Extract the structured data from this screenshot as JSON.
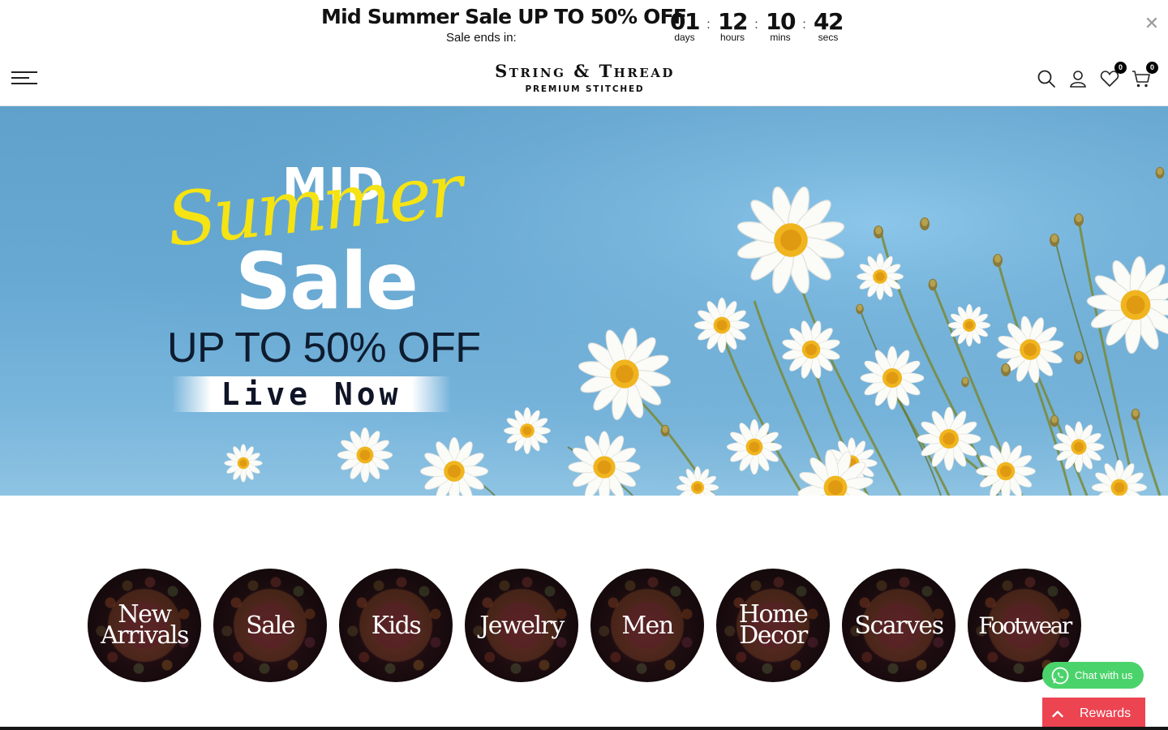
{
  "announcement": {
    "title": "Mid Summer Sale UP TO 50% OFF",
    "subtitle": "Sale ends in:",
    "countdown": [
      {
        "value": "01",
        "label": "days"
      },
      {
        "value": "12",
        "label": "hours"
      },
      {
        "value": "10",
        "label": "mins"
      },
      {
        "value": "42",
        "label": "secs"
      }
    ],
    "separator": ":",
    "close_icon": "close-icon"
  },
  "header": {
    "logo_main": "String & Thread",
    "logo_sub": "PREMIUM STITCHED",
    "icons": [
      "menu-icon",
      "search-icon",
      "account-icon",
      "wishlist-icon",
      "cart-icon"
    ],
    "wishlist_count": "0",
    "cart_count": "0"
  },
  "hero": {
    "line1": "MID",
    "line2": "Summer",
    "line3": "Sale",
    "line4": "UP TO 50% OFF",
    "cta": "Live Now",
    "accent_color": "#f5e313"
  },
  "categories": [
    {
      "label": "New Arrivals"
    },
    {
      "label": "Sale"
    },
    {
      "label": "Kids"
    },
    {
      "label": "Jewelry"
    },
    {
      "label": "Men"
    },
    {
      "label": "Home Decor"
    },
    {
      "label": "Scarves"
    },
    {
      "label": "Footwear"
    }
  ],
  "widgets": {
    "chat_label": "Chat with us",
    "chat_color": "#4bd36b",
    "rewards_label": "Rewards",
    "rewards_color": "#ec4451"
  }
}
